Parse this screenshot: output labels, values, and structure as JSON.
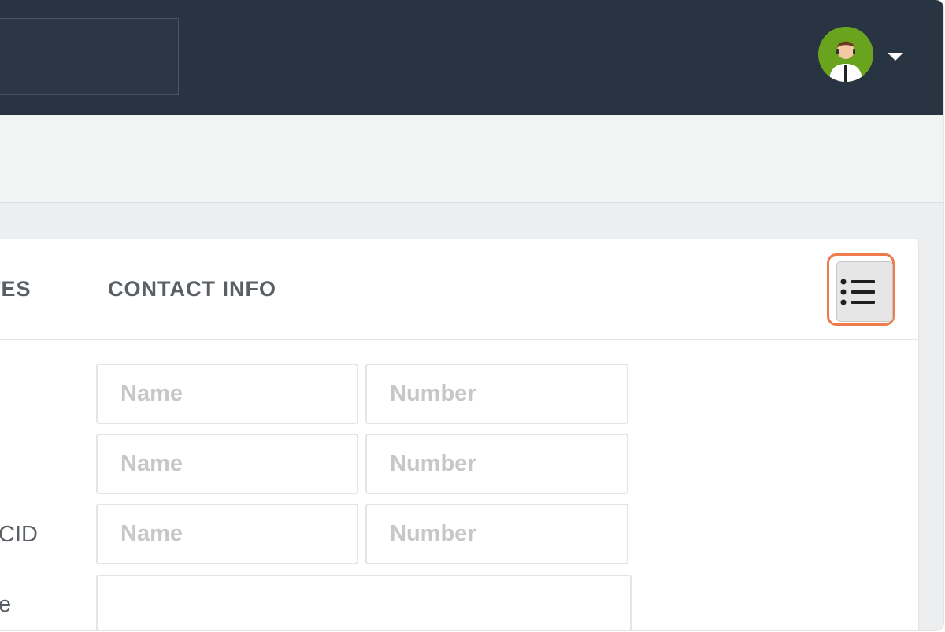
{
  "topbar": {
    "search_value": "",
    "avatar_icon": "user-avatar-icon",
    "dropdown_icon": "caret-down-icon"
  },
  "tabs": {
    "notes_partial": "TES",
    "contact_info": "CONTACT INFO"
  },
  "toolbar": {
    "menu_icon": "list-icon",
    "highlight_color": "#ef7a4b"
  },
  "form": {
    "rows": [
      {
        "label": "",
        "name_placeholder": "Name",
        "number_placeholder": "Number"
      },
      {
        "label": "",
        "name_placeholder": "Name",
        "number_placeholder": "Number"
      },
      {
        "label": "CID",
        "name_placeholder": "Name",
        "number_placeholder": "Number"
      },
      {
        "label": "e",
        "value": ""
      }
    ]
  },
  "colors": {
    "topbar_bg": "#293442",
    "avatar_bg": "#6aa31e",
    "tab_text": "#5a5f66",
    "placeholder": "#c7c7c7"
  }
}
